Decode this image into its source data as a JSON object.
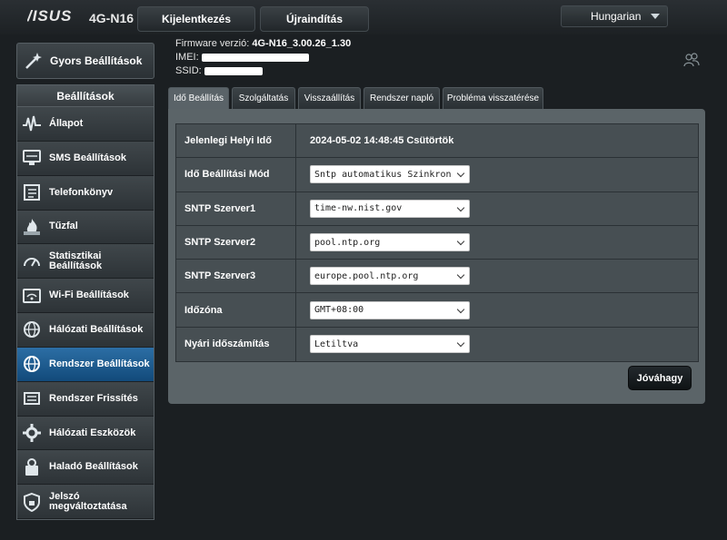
{
  "brand": {
    "logo": "/ISUS",
    "model": "4G-N16"
  },
  "header": {
    "logout_label": "Kijelentkezés",
    "reboot_label": "Újraindítás",
    "language": "Hungarian"
  },
  "info": {
    "firmware_label": "Firmware verzió:",
    "firmware_value": "4G-N16_3.00.26_1.30",
    "imei_label": "IMEI:",
    "ssid_label": "SSID:"
  },
  "sidebar": {
    "quick_setup": "Gyors Beállítások",
    "section_title": "Beállítások",
    "items": [
      {
        "label": "Állapot",
        "icon": "status-wave-icon"
      },
      {
        "label": "SMS Beállítások",
        "icon": "sms-icon"
      },
      {
        "label": "Telefonkönyv",
        "icon": "phonebook-icon"
      },
      {
        "label": "Tűzfal",
        "icon": "firewall-icon"
      },
      {
        "label": "Statisztikai Beállítások",
        "icon": "statistics-icon"
      },
      {
        "label": "Wi-Fi Beállítások",
        "icon": "wifi-icon"
      },
      {
        "label": "Hálózati Beállítások",
        "icon": "globe-icon"
      },
      {
        "label": "Rendszer Beállítások",
        "icon": "system-globe-icon",
        "active": true
      },
      {
        "label": "Rendszer Frissítés",
        "icon": "upgrade-icon"
      },
      {
        "label": "Hálózati Eszközök",
        "icon": "network-tools-icon"
      },
      {
        "label": "Haladó Beállítások",
        "icon": "advanced-settings-icon"
      },
      {
        "label": "Jelszó megváltoztatása",
        "icon": "lock-icon"
      }
    ]
  },
  "tabs": [
    {
      "label": "Idő Beállítás",
      "active": true
    },
    {
      "label": "Szolgáltatás"
    },
    {
      "label": "Visszaállítás"
    },
    {
      "label": "Rendszer napló"
    },
    {
      "label": "Probléma visszatérése"
    }
  ],
  "form": {
    "rows": [
      {
        "label": "Jelenlegi Helyi Idő",
        "value": "2024-05-02 14:48:45 Csütörtök"
      },
      {
        "label": "Idő Beállítási Mód",
        "select": "Sntp automatikus Szinkron"
      },
      {
        "label": "SNTP Szerver1",
        "select": "time-nw.nist.gov"
      },
      {
        "label": "SNTP Szerver2",
        "select": "pool.ntp.org"
      },
      {
        "label": "SNTP Szerver3",
        "select": "europe.pool.ntp.org"
      },
      {
        "label": "Időzóna",
        "select": "GMT+08:00"
      },
      {
        "label": "Nyári időszámítás",
        "select": "Letiltva"
      }
    ],
    "apply_label": "Jóváhagy"
  },
  "colors": {
    "active_menu": "#1e5c91",
    "panel": "#5b6468",
    "background": "#1b1f22"
  }
}
